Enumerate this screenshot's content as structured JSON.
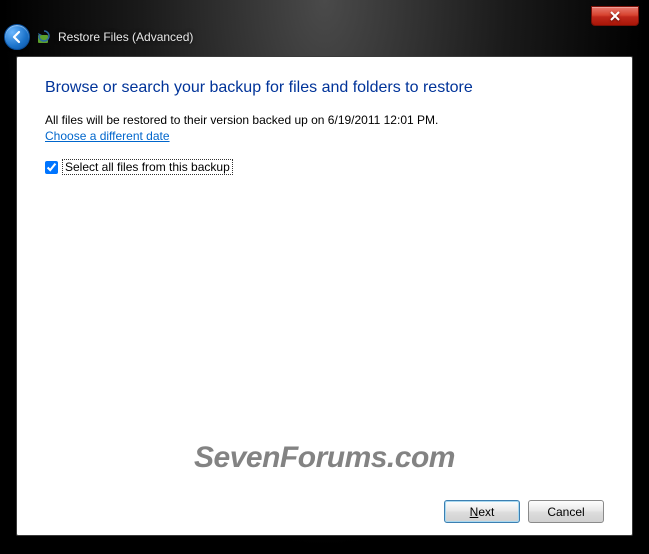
{
  "window": {
    "title": "Restore Files (Advanced)"
  },
  "main": {
    "heading": "Browse or search your backup for files and folders to restore",
    "description": "All files will be restored to their version backed up on 6/19/2011 12:01 PM.",
    "choose_date_link": "Choose a different date",
    "select_all_label": "Select all files from this backup",
    "select_all_checked": true
  },
  "buttons": {
    "next_prefix": "N",
    "next_suffix": "ext",
    "cancel": "Cancel"
  },
  "watermark": "SevenForums.com"
}
